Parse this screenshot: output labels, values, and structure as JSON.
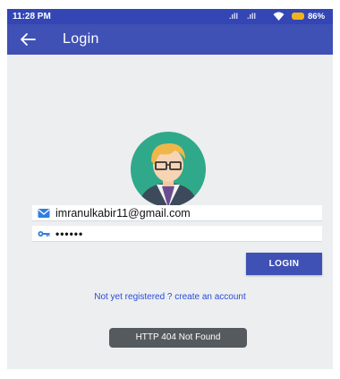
{
  "status_bar": {
    "time": "11:28 PM",
    "signal_1": ".ıll",
    "signal_2": ".ıll",
    "wifi": "wifi-icon",
    "battery_percent": "86%"
  },
  "app_bar": {
    "title": "Login",
    "back_icon": "arrow-left-icon"
  },
  "avatar": {
    "icon": "user-avatar-icon"
  },
  "form": {
    "email": {
      "icon": "envelope-icon",
      "value": "imranulkabir11@gmail.com"
    },
    "password": {
      "icon": "key-icon",
      "value": "••••••"
    },
    "login_label": "LOGIN"
  },
  "register_link": "Not yet registered ? create an account",
  "toast": "HTTP 404 Not Found",
  "colors": {
    "primary": "#3f51b5",
    "status_bar": "#3346b4",
    "background": "#eceef0",
    "link": "#2b4bd8",
    "toast_bg": "#555a5e",
    "battery": "#f1b41b"
  }
}
